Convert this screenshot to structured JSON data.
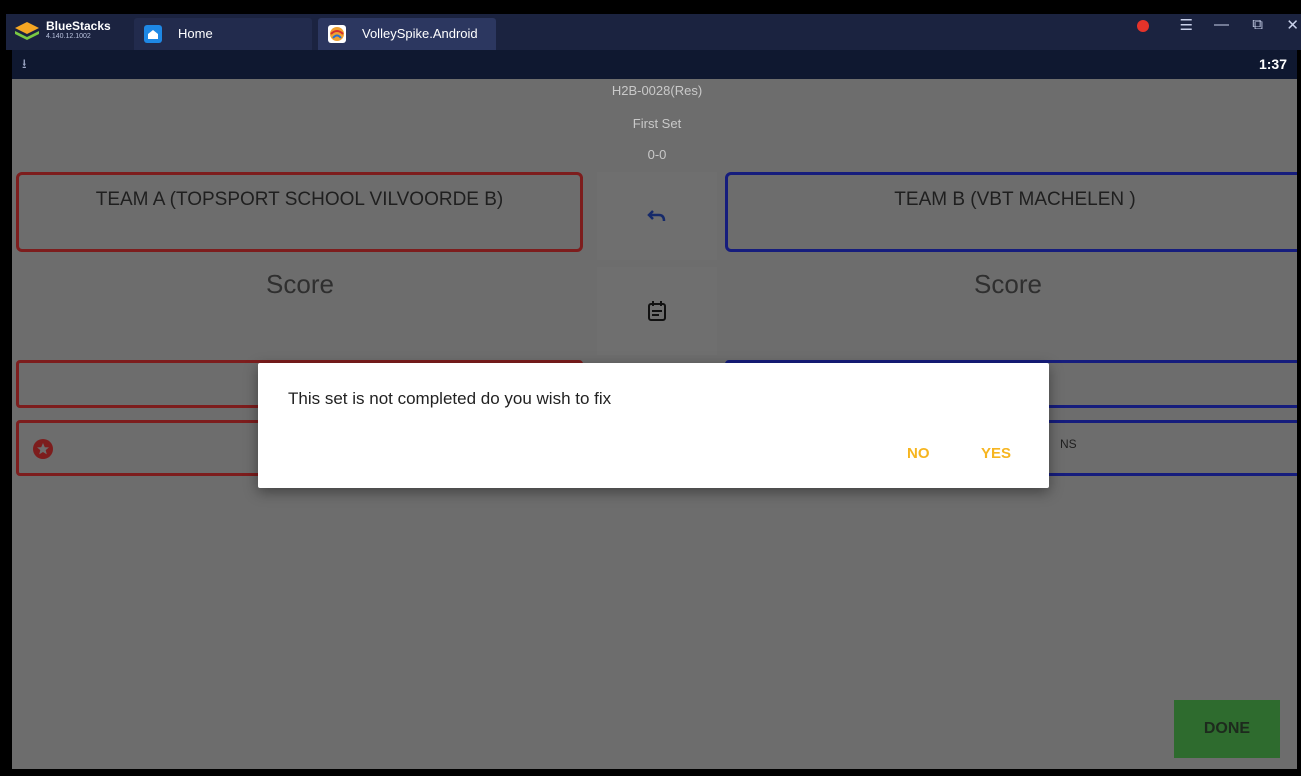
{
  "window": {
    "brand": "BlueStacks",
    "version": "4.140.12.1002",
    "tabs": [
      {
        "label": "Home",
        "icon": "home-icon"
      },
      {
        "label": "VolleySpike.Android",
        "icon": "app-icon"
      }
    ],
    "controls": {
      "menu": "☰",
      "minimize": "—",
      "restore": "⧉",
      "close": "✕"
    }
  },
  "statusbar": {
    "clock": "1:37",
    "download": "⭳"
  },
  "match": {
    "code": "H2B-0028(Res)",
    "set_label": "First Set",
    "set_score": "0-0"
  },
  "team_a": {
    "name": "TEAM A (TOPSPORT SCHOOL VILVOORDE B)",
    "score_label": "Score"
  },
  "team_b": {
    "name": "TEAM B (VBT MACHELEN )",
    "score_label": "Score",
    "row_fragment": "NS"
  },
  "done_label": "DONE",
  "dialog": {
    "message": "This set is not completed do you wish to fix",
    "no_label": "NO",
    "yes_label": "YES"
  },
  "colors": {
    "team_a_accent": "#7d1d1d",
    "team_b_accent": "#161d7d",
    "dialog_button": "#f6b520",
    "done_button": "#2e6b2e"
  }
}
